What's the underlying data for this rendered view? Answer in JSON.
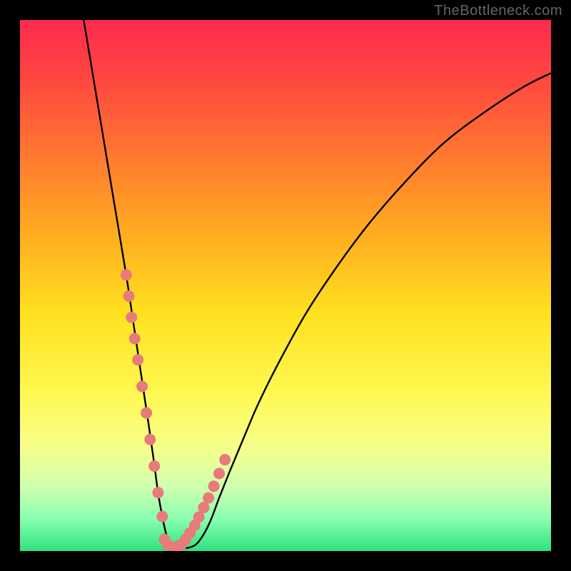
{
  "watermark": "TheBottleneck.com",
  "chart_data": {
    "type": "line",
    "title": "",
    "xlabel": "",
    "ylabel": "",
    "xlim": [
      0,
      100
    ],
    "ylim": [
      0,
      100
    ],
    "gradient_stops": [
      {
        "offset": 0,
        "color": "#ff2a4f"
      },
      {
        "offset": 12,
        "color": "#ff4a3f"
      },
      {
        "offset": 26,
        "color": "#ff7a2f"
      },
      {
        "offset": 40,
        "color": "#ffab20"
      },
      {
        "offset": 55,
        "color": "#ffe020"
      },
      {
        "offset": 70,
        "color": "#fff850"
      },
      {
        "offset": 80,
        "color": "#f8ff88"
      },
      {
        "offset": 88,
        "color": "#d0ffb0"
      },
      {
        "offset": 94,
        "color": "#88ffb0"
      },
      {
        "offset": 100,
        "color": "#30e080"
      }
    ],
    "series": [
      {
        "name": "bottleneck-curve",
        "type": "line",
        "x": [
          12,
          14,
          16,
          18,
          20,
          21.5,
          23,
          24.2,
          25.2,
          26,
          26.8,
          27.6,
          28.6,
          30.2,
          32.8,
          34.5,
          36,
          37.5,
          39.5,
          42,
          45,
          49,
          54,
          60,
          66,
          73,
          80,
          88,
          95,
          100
        ],
        "y": [
          100,
          88,
          76,
          64,
          52,
          42,
          32,
          24,
          17,
          11,
          6.5,
          3,
          1,
          0.5,
          1,
          3,
          6,
          10,
          15,
          21,
          28,
          36,
          45,
          54,
          62,
          70,
          77,
          83,
          87.5,
          90
        ]
      },
      {
        "name": "left-markers",
        "type": "scatter",
        "x": [
          20.0,
          20.5,
          21.0,
          21.6,
          22.2,
          23.0,
          23.8,
          24.5,
          25.3,
          26.0,
          26.8
        ],
        "y": [
          52,
          48,
          44,
          40,
          36,
          31,
          26,
          21,
          16,
          11,
          6.5
        ]
      },
      {
        "name": "right-markers",
        "type": "scatter",
        "x": [
          30.4,
          31.2,
          32.0,
          32.9,
          33.7,
          34.6,
          35.5,
          36.5,
          37.5,
          38.6
        ],
        "y": [
          1.2,
          2.2,
          3.4,
          4.8,
          6.4,
          8.2,
          10.0,
          12.2,
          14.6,
          17.2
        ]
      },
      {
        "name": "bottom-markers",
        "type": "scatter",
        "x": [
          27.2,
          27.8,
          28.6,
          29.4,
          30.0
        ],
        "y": [
          2.2,
          1.2,
          0.7,
          0.7,
          1.0
        ]
      }
    ],
    "marker_style": {
      "color": "#e87a7a",
      "radius": 8
    }
  }
}
